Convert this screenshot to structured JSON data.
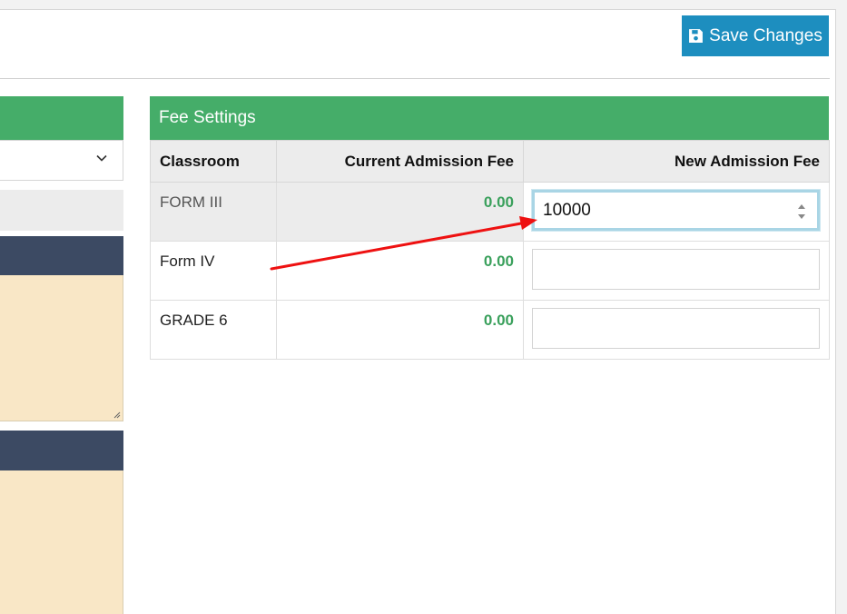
{
  "toolbar": {
    "save_label": "Save Changes",
    "save_icon": "floppy-disk-icon"
  },
  "fee_settings": {
    "title": "Fee Settings",
    "columns": [
      "Classroom",
      "Current Admission Fee",
      "New Admission Fee"
    ],
    "rows": [
      {
        "classroom": "FORM III",
        "current_fee": "0.00",
        "new_fee": "10000",
        "active": true
      },
      {
        "classroom": "Form IV",
        "current_fee": "0.00",
        "new_fee": ""
      },
      {
        "classroom": "GRADE 6",
        "current_fee": "0.00",
        "new_fee": ""
      }
    ]
  },
  "colors": {
    "header_green": "#45ad69",
    "button_blue": "#1d8ebf",
    "fee_green": "#3aa05c",
    "sidebar_dark": "#3c4a63",
    "sidebar_beige": "#f9e7c6",
    "annotation_red": "#ee1111"
  }
}
